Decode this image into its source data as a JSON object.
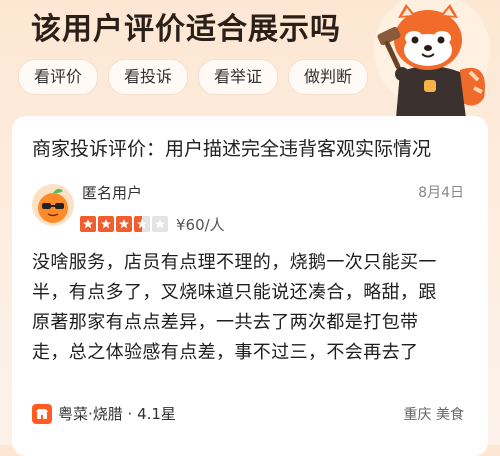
{
  "header": {
    "title": "该用户评价适合展示吗",
    "chips": [
      {
        "label": "看评价"
      },
      {
        "label": "看投诉"
      },
      {
        "label": "看举证"
      },
      {
        "label": "做判断"
      }
    ]
  },
  "card": {
    "headline": "商家投诉评价：用户描述完全违背客观实际情况",
    "user": {
      "name": "匿名用户",
      "date": "8月4日"
    },
    "rating": {
      "stars": 3.5,
      "max": 5,
      "price": "¥60/人"
    },
    "review_lines": [
      "没啥服务，店员有点理不理的，烧鹅一次只能买一",
      "半，有点多了，叉烧味道只能说还凑合，略甜，跟",
      "原著那家有点点差异，一共去了两次都是打包带",
      "走，总之体验感有点差，事不过三，不会再去了"
    ],
    "shop": {
      "tag": "粤菜·烧腊 · 4.1星"
    },
    "location": "重庆 美食"
  },
  "colors": {
    "accent": "#f15d2d",
    "background": "#fde7d3",
    "card": "#ffffff"
  }
}
